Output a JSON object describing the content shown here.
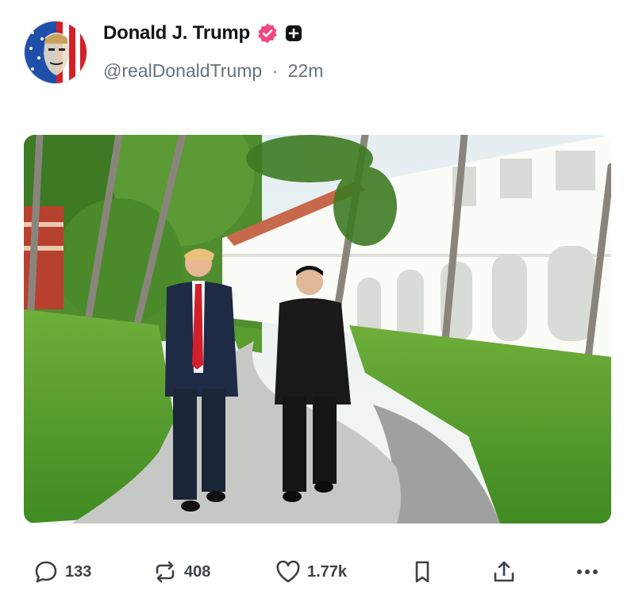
{
  "post": {
    "author": {
      "display_name": "Donald J. Trump",
      "handle": "@realDonaldTrump",
      "verified": true,
      "avatar_icon": "flag-portrait-avatar"
    },
    "separator": "·",
    "timestamp": "22m",
    "media": {
      "type": "photo",
      "icon": "photo-two-men-walking-garden"
    },
    "actions": {
      "replies": "133",
      "reposts": "408",
      "likes": "1.77k"
    }
  },
  "colors": {
    "verified_badge": "#f0477e",
    "text_primary": "#0f1419",
    "text_secondary": "#66727f",
    "icon": "#3b4248"
  }
}
